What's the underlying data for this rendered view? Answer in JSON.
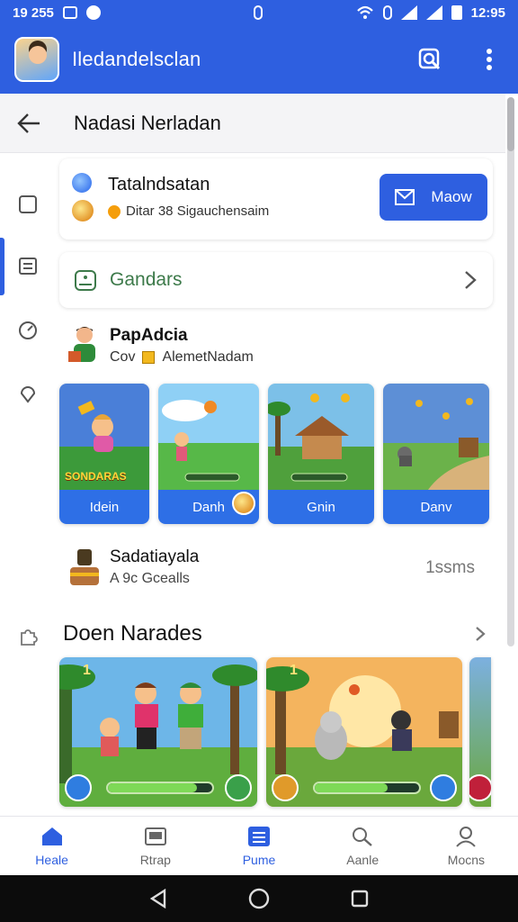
{
  "status_bar": {
    "time_left": "19 255",
    "time_right": "12:95"
  },
  "app_bar": {
    "title": "Iledandelsclan"
  },
  "sub_header": {
    "title": "Nadasi Nerladan"
  },
  "mission_card": {
    "title": "Tatalndsatan",
    "subtitle": "Ditar 38 Sigauchensaim",
    "button_label": "Maow"
  },
  "category_row": {
    "label": "Gandars"
  },
  "player": {
    "name": "PapAdcia",
    "tag": "Cov",
    "detail": "AlemetNadam"
  },
  "game_tiles": [
    {
      "label": "Idein",
      "banner": "SONDARAS"
    },
    {
      "label": "Danh"
    },
    {
      "label": "Gnin"
    },
    {
      "label": "Danv"
    }
  ],
  "list_item": {
    "name": "Sadatiayala",
    "subtitle": "A 9c Gcealls",
    "meta": "1ssms"
  },
  "section": {
    "title": "Doen Narades"
  },
  "featured": [
    {
      "level": "1",
      "progress": 0.85
    },
    {
      "level": "1",
      "progress": 0.7
    }
  ],
  "bottom_nav": [
    {
      "label": "Heale",
      "icon": "home-icon",
      "active": true
    },
    {
      "label": "Rtrap",
      "icon": "store-icon",
      "active": false
    },
    {
      "label": "Pume",
      "icon": "list-icon",
      "active": true
    },
    {
      "label": "Aanle",
      "icon": "search-icon",
      "active": false
    },
    {
      "label": "Mocns",
      "icon": "profile-icon",
      "active": false
    }
  ],
  "colors": {
    "brand": "#2e5fe0",
    "accent_green": "#3d7a4a"
  }
}
